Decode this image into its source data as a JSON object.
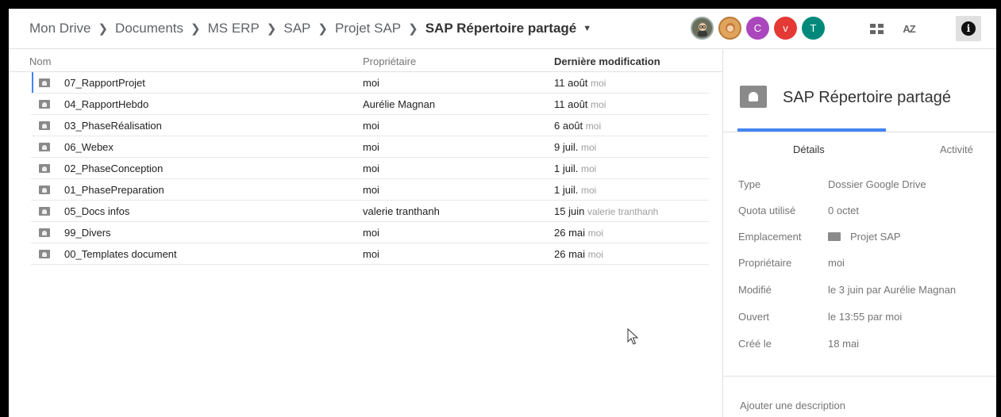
{
  "breadcrumb": {
    "items": [
      "Mon Drive",
      "Documents",
      "MS ERP",
      "SAP",
      "Projet SAP",
      "SAP Répertoire partagé"
    ]
  },
  "avatars": [
    {
      "letter": "",
      "kind": "photo",
      "color": "#6b6f5a"
    },
    {
      "letter": "",
      "kind": "photo",
      "color": "#e0a45c"
    },
    {
      "letter": "C",
      "kind": "letter",
      "color": "#ab47bc"
    },
    {
      "letter": "v",
      "kind": "letter",
      "color": "#e53935"
    },
    {
      "letter": "T",
      "kind": "letter",
      "color": "#00897b"
    }
  ],
  "toolbar": {
    "grid_icon": "grid-view-icon",
    "sort_icon": "sort-az-icon",
    "sort_label": "AZ",
    "info_icon": "info-icon",
    "info_label": "i"
  },
  "list": {
    "headers": {
      "name": "Nom",
      "owner": "Propriétaire",
      "modified": "Dernière modification"
    },
    "rows": [
      {
        "name": "07_RapportProjet",
        "owner": "moi",
        "date": "11 août",
        "by": "moi"
      },
      {
        "name": "04_RapportHebdo",
        "owner": "Aurélie Magnan",
        "date": "11 août",
        "by": "moi"
      },
      {
        "name": "03_PhaseRéalisation",
        "owner": "moi",
        "date": "6 août",
        "by": "moi"
      },
      {
        "name": "06_Webex",
        "owner": "moi",
        "date": "9 juil.",
        "by": "moi"
      },
      {
        "name": "02_PhaseConception",
        "owner": "moi",
        "date": "1 juil.",
        "by": "moi"
      },
      {
        "name": "01_PhasePreparation",
        "owner": "moi",
        "date": "1 juil.",
        "by": "moi"
      },
      {
        "name": "05_Docs infos",
        "owner": "valerie tranthanh",
        "date": "15 juin",
        "by": "valerie tranthanh"
      },
      {
        "name": "99_Divers",
        "owner": "moi",
        "date": "26 mai",
        "by": "moi"
      },
      {
        "name": "00_Templates document",
        "owner": "moi",
        "date": "26 mai",
        "by": "moi"
      }
    ]
  },
  "panel": {
    "title": "SAP Répertoire partagé",
    "tabs": {
      "details": "Détails",
      "activity": "Activité"
    },
    "details": [
      {
        "label": "Type",
        "value": "Dossier Google Drive"
      },
      {
        "label": "Quota utilisé",
        "value": "0 octet"
      },
      {
        "label": "Emplacement",
        "value": "Projet SAP"
      },
      {
        "label": "Propriétaire",
        "value": "moi"
      },
      {
        "label": "Modifié",
        "value": "le 3 juin par Aurélie Magnan"
      },
      {
        "label": "Ouvert",
        "value": "le 13:55 par moi"
      },
      {
        "label": "Créé le",
        "value": "18 mai"
      }
    ],
    "add_description": "Ajouter une description"
  },
  "colors": {
    "accent": "#4285f4",
    "folder": "#8a8a8a"
  }
}
